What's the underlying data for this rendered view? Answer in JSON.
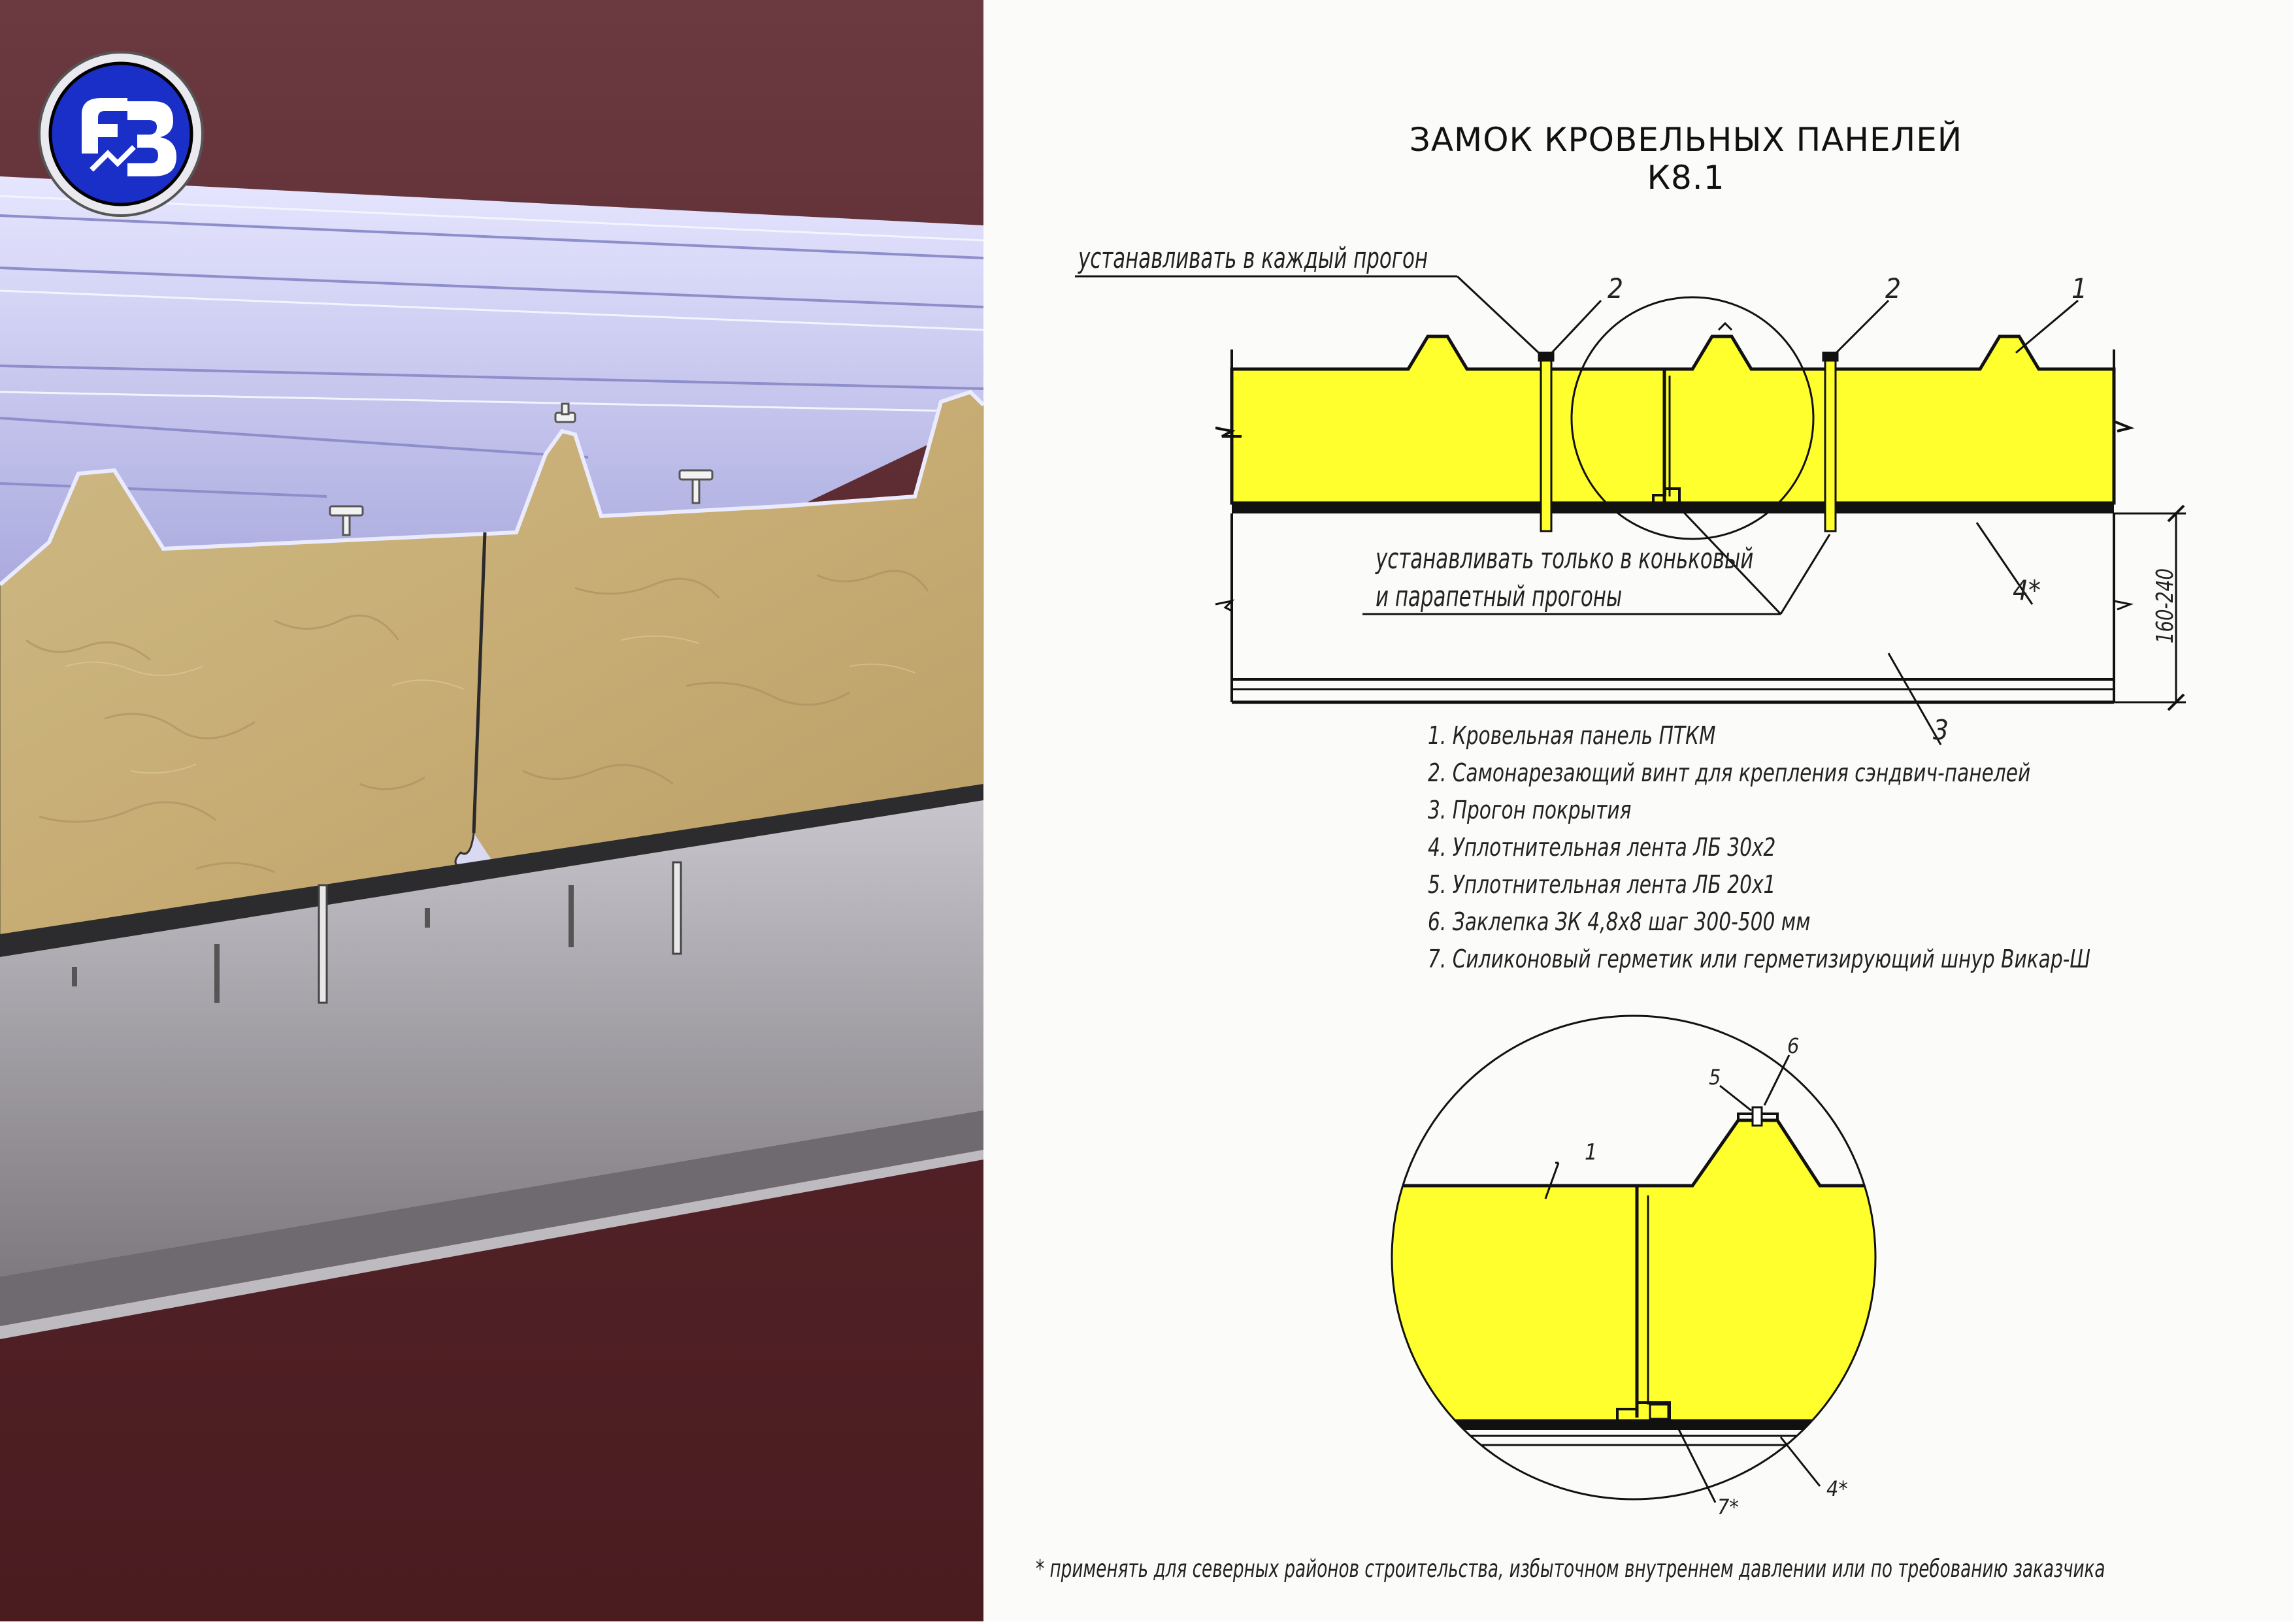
{
  "title": "ЗАМОК КРОВЕЛЬНЫХ ПАНЕЛЕЙ К8.1",
  "callouts": {
    "each_purlin": "устанавливать в каждый прогон",
    "ridge_line1": "устанавливать только в коньковый",
    "ridge_line2": "и парапетный прогоны",
    "dimension": "160-240"
  },
  "markers": {
    "m1": "1",
    "m2": "2",
    "m3": "3",
    "m4": "4*",
    "m5": "5",
    "m6": "6",
    "m7": "7*"
  },
  "legend": [
    "1. Кровельная панель ПТКМ",
    "2. Самонарезающий винт для крепления сэндвич-панелей",
    "3. Прогон покрытия",
    "4. Уплотнительная лента ЛБ 30х2",
    "5. Уплотнительная лента ЛБ 20х1",
    "6. Заклепка ЗК 4,8х8 шаг 300-500 мм",
    "7. Силиконовый герметик или герметизирующий шнур Викар-Ш"
  ],
  "footnote": "* применять для северных районов строительства, избыточном внутреннем давлении или по требованию заказчика",
  "colors": {
    "insulation_yellow": "#ffff2e",
    "background_maroon": "#5a262b",
    "metal_sheet": "#c2c2ee",
    "mineral_wool": "#c9b07a",
    "purlin_grey": "#9a969c",
    "logo_blue": "#1a2fc8"
  },
  "icons": {
    "logo": "company-logo-icon"
  }
}
